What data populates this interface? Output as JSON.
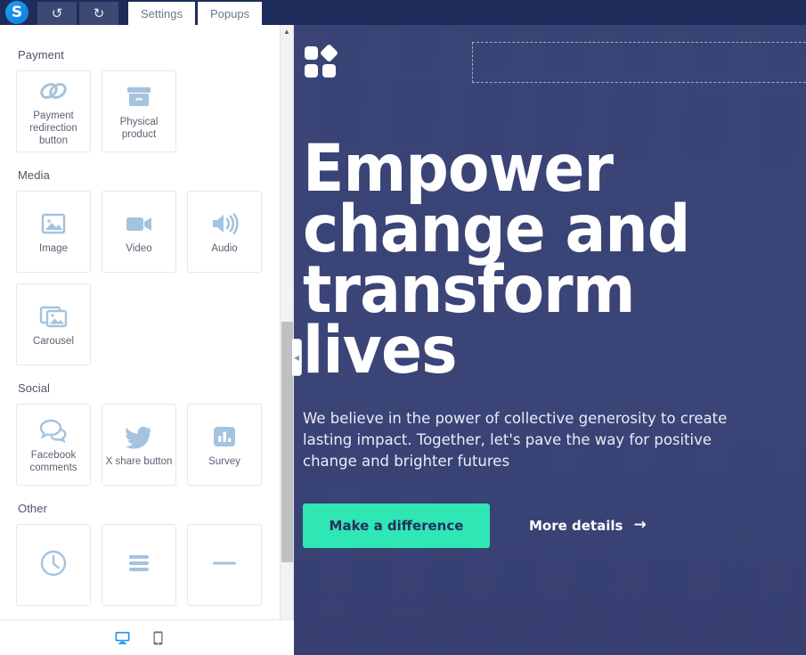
{
  "topbar": {
    "logo_letter": "S",
    "undo_label": "↺",
    "redo_label": "↻",
    "tabs": [
      {
        "label": "Settings"
      },
      {
        "label": "Popups"
      }
    ]
  },
  "sidebar": {
    "sections": [
      {
        "title": "Payment",
        "items": [
          {
            "label": "Payment redirection button",
            "icon": "link-icon"
          },
          {
            "label": "Physical product",
            "icon": "box-icon"
          }
        ]
      },
      {
        "title": "Media",
        "items": [
          {
            "label": "Image",
            "icon": "image-icon"
          },
          {
            "label": "Video",
            "icon": "video-camera-icon"
          },
          {
            "label": "Audio",
            "icon": "speaker-icon"
          },
          {
            "label": "Carousel",
            "icon": "carousel-icon"
          }
        ]
      },
      {
        "title": "Social",
        "items": [
          {
            "label": "Facebook comments",
            "icon": "speech-bubbles-icon"
          },
          {
            "label": "X share button",
            "icon": "bird-icon"
          },
          {
            "label": "Survey",
            "icon": "bar-chart-icon"
          }
        ]
      },
      {
        "title": "Other",
        "items": [
          {
            "label": "",
            "icon": "clock-icon"
          },
          {
            "label": "",
            "icon": "menu-lines-icon"
          },
          {
            "label": "",
            "icon": "divider-line-icon"
          }
        ]
      }
    ],
    "scrollbar": {
      "up": "▲",
      "down": "▼"
    },
    "collapse_handle": "◀"
  },
  "device_bar": {
    "desktop_label": "Desktop view",
    "mobile_label": "Mobile view",
    "active": "desktop"
  },
  "canvas": {
    "brand_mark": "four-squares-logo",
    "nav_dropzone_label": "",
    "hero": {
      "title": "Empower\nchange and\ntransform lives",
      "subtitle": "We believe in the power of collective generosity to create lasting impact. Together, let's pave the way for positive change and brighter futures",
      "primary_cta": "Make a difference",
      "secondary_cta": "More details",
      "secondary_cta_arrow": "→"
    }
  },
  "colors": {
    "topbar_bg": "#1e2c5c",
    "hero_bg": "#3c4679",
    "primary_cta_bg": "#2fe6b5",
    "primary_cta_text": "#24305e",
    "tile_icon": "#a4c3de",
    "device_active": "#2196f3"
  }
}
